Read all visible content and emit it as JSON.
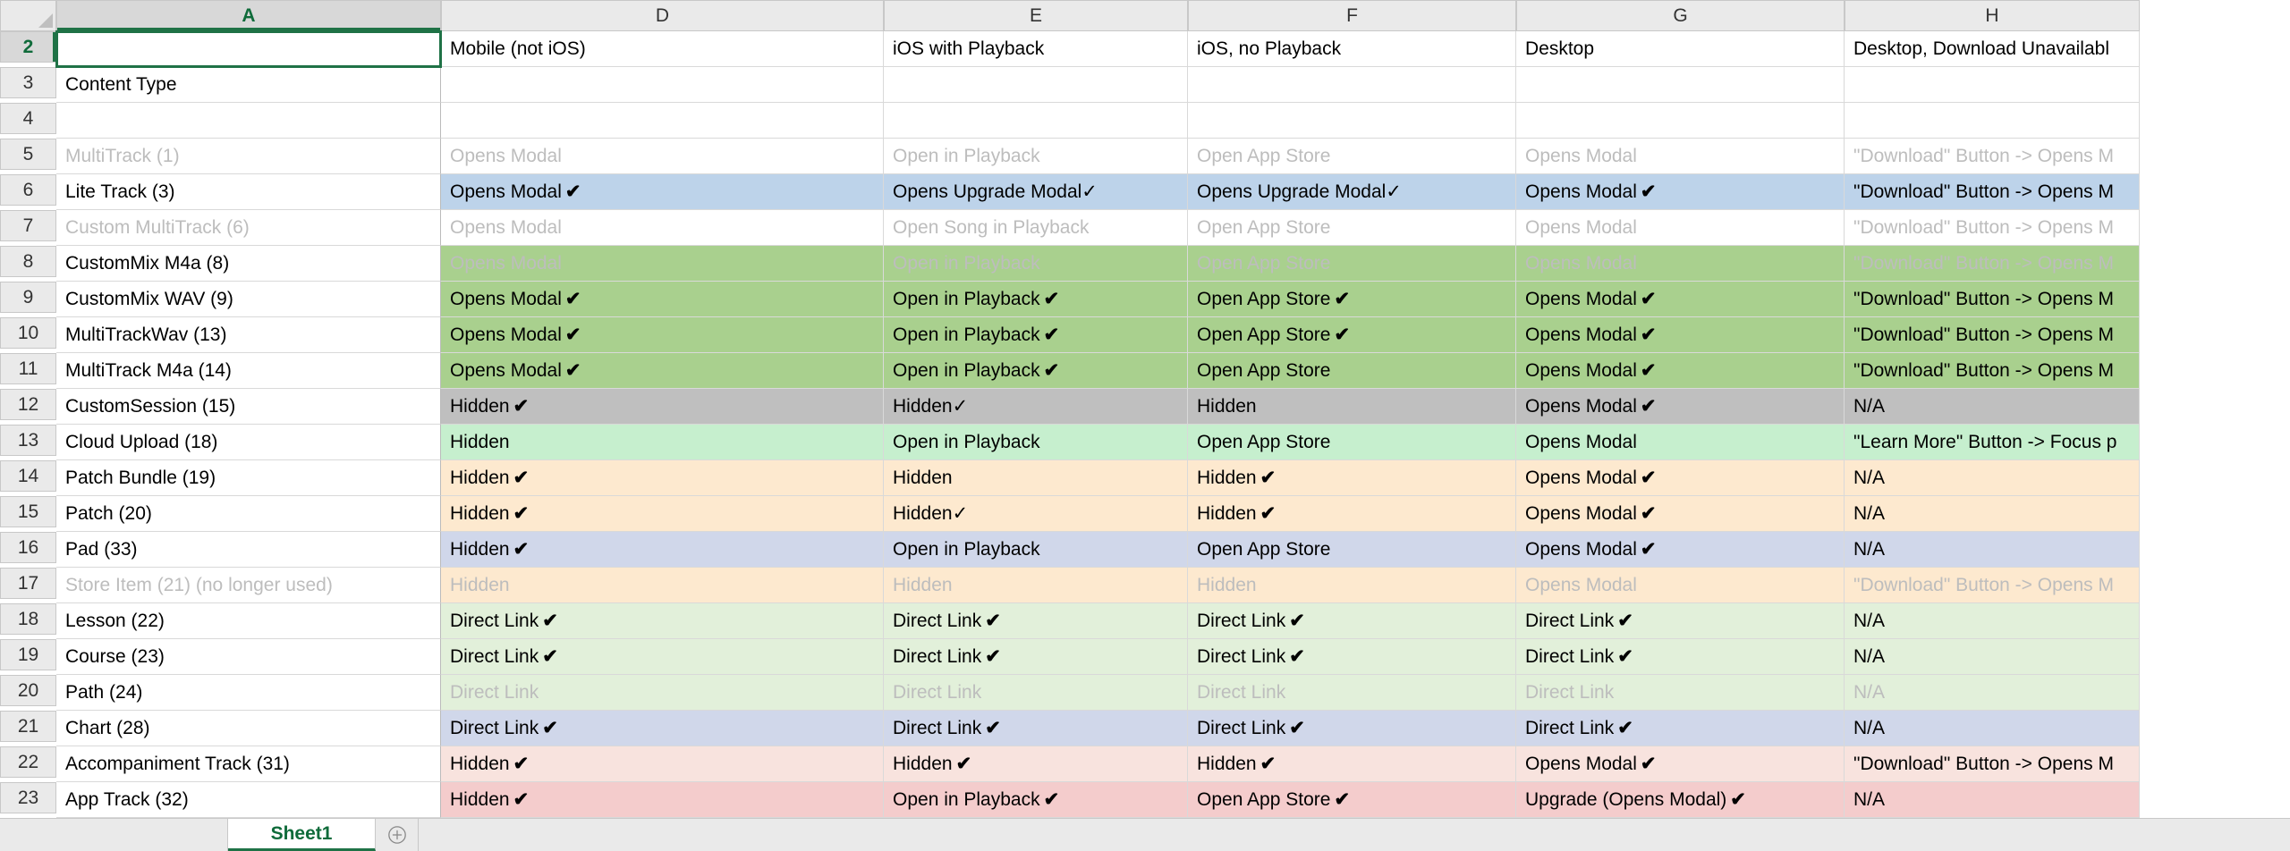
{
  "column_headers": [
    "A",
    "D",
    "E",
    "F",
    "G",
    "H"
  ],
  "active_column_index": 0,
  "active_row_number": 2,
  "sheet_tab": "Sheet1",
  "rows": [
    {
      "num": 2,
      "active": true,
      "cells": [
        {
          "text": "",
          "selected": true
        },
        {
          "text": "Mobile (not iOS)"
        },
        {
          "text": "iOS with Playback"
        },
        {
          "text": "iOS, no Playback"
        },
        {
          "text": "Desktop"
        },
        {
          "text": "Desktop, Download Unavailabl"
        }
      ]
    },
    {
      "num": 3,
      "cells": [
        {
          "text": "Content Type"
        },
        {
          "text": ""
        },
        {
          "text": ""
        },
        {
          "text": ""
        },
        {
          "text": ""
        },
        {
          "text": ""
        }
      ]
    },
    {
      "num": 4,
      "cells": [
        {
          "text": ""
        },
        {
          "text": ""
        },
        {
          "text": ""
        },
        {
          "text": ""
        },
        {
          "text": ""
        },
        {
          "text": ""
        }
      ]
    },
    {
      "num": 5,
      "cells": [
        {
          "text": "MultiTrack (1)",
          "muted": true
        },
        {
          "text": "Opens Modal",
          "muted": true
        },
        {
          "text": "Open in Playback",
          "muted": true
        },
        {
          "text": "Open App Store",
          "muted": true
        },
        {
          "text": "Opens Modal",
          "muted": true
        },
        {
          "text": "\"Download\" Button -> Opens M",
          "muted": true
        }
      ]
    },
    {
      "num": 6,
      "cells": [
        {
          "text": "Lite Track (3)"
        },
        {
          "text": "Opens Modal",
          "check": true,
          "bg": "bg-blue"
        },
        {
          "text": "Opens Upgrade Modal",
          "check_light": true,
          "bg": "bg-blue"
        },
        {
          "text": "Opens Upgrade Modal",
          "check_light": true,
          "bg": "bg-blue"
        },
        {
          "text": "Opens Modal",
          "check": true,
          "bg": "bg-blue"
        },
        {
          "text": "\"Download\" Button -> Opens M",
          "bg": "bg-blue"
        }
      ]
    },
    {
      "num": 7,
      "cells": [
        {
          "text": "Custom MultiTrack (6)",
          "muted": true
        },
        {
          "text": "Opens Modal",
          "muted": true
        },
        {
          "text": "Open Song in Playback",
          "muted": true
        },
        {
          "text": "Open App Store",
          "muted": true
        },
        {
          "text": "Opens Modal",
          "muted": true
        },
        {
          "text": "\"Download\" Button -> Opens M",
          "muted": true
        }
      ]
    },
    {
      "num": 8,
      "cells": [
        {
          "text": "CustomMix M4a (8)"
        },
        {
          "text": "Opens Modal",
          "muted": true,
          "bg": "bg-green-strong"
        },
        {
          "text": "Open in Playback",
          "muted": true,
          "bg": "bg-green-strong"
        },
        {
          "text": "Open App Store",
          "muted": true,
          "bg": "bg-green-strong"
        },
        {
          "text": "Opens Modal",
          "muted": true,
          "bg": "bg-green-strong"
        },
        {
          "text": "\"Download\" Button -> Opens M",
          "muted": true,
          "bg": "bg-green-strong"
        }
      ]
    },
    {
      "num": 9,
      "cells": [
        {
          "text": "CustomMix WAV (9)"
        },
        {
          "text": "Opens Modal",
          "check": true,
          "bg": "bg-green-strong"
        },
        {
          "text": "Open in Playback",
          "check": true,
          "bg": "bg-green-strong"
        },
        {
          "text": "Open App Store",
          "check": true,
          "bg": "bg-green-strong"
        },
        {
          "text": "Opens Modal",
          "check": true,
          "bg": "bg-green-strong"
        },
        {
          "text": "\"Download\" Button -> Opens M",
          "bg": "bg-green-strong"
        }
      ]
    },
    {
      "num": 10,
      "cells": [
        {
          "text": "MultiTrackWav (13)"
        },
        {
          "text": "Opens Modal",
          "check": true,
          "bg": "bg-green-strong"
        },
        {
          "text": "Open in Playback",
          "check": true,
          "bg": "bg-green-strong"
        },
        {
          "text": "Open App Store",
          "check": true,
          "bg": "bg-green-strong"
        },
        {
          "text": "Opens Modal",
          "check": true,
          "bg": "bg-green-strong"
        },
        {
          "text": "\"Download\" Button -> Opens M",
          "bg": "bg-green-strong"
        }
      ]
    },
    {
      "num": 11,
      "cells": [
        {
          "text": "MultiTrack M4a (14)"
        },
        {
          "text": "Opens Modal",
          "check": true,
          "bg": "bg-green-strong"
        },
        {
          "text": "Open in Playback",
          "check": true,
          "bg": "bg-green-strong"
        },
        {
          "text": "Open App Store",
          "bg": "bg-green-strong"
        },
        {
          "text": "Opens Modal",
          "check": true,
          "bg": "bg-green-strong"
        },
        {
          "text": "\"Download\" Button -> Opens M",
          "bg": "bg-green-strong"
        }
      ]
    },
    {
      "num": 12,
      "cells": [
        {
          "text": "CustomSession (15)"
        },
        {
          "text": "Hidden",
          "check": true,
          "bg": "bg-gray"
        },
        {
          "text": "Hidden",
          "check_light": true,
          "bg": "bg-gray"
        },
        {
          "text": "Hidden",
          "bg": "bg-gray"
        },
        {
          "text": "Opens Modal",
          "check": true,
          "bg": "bg-gray"
        },
        {
          "text": "N/A",
          "bg": "bg-gray"
        }
      ]
    },
    {
      "num": 13,
      "cells": [
        {
          "text": "Cloud Upload (18)"
        },
        {
          "text": "Hidden",
          "bg": "bg-green"
        },
        {
          "text": "Open in Playback",
          "bg": "bg-green"
        },
        {
          "text": "Open App Store",
          "bg": "bg-green"
        },
        {
          "text": "Opens Modal",
          "bg": "bg-green"
        },
        {
          "text": "\"Learn More\" Button -> Focus p",
          "bg": "bg-green"
        }
      ]
    },
    {
      "num": 14,
      "cells": [
        {
          "text": "Patch Bundle (19)"
        },
        {
          "text": "Hidden",
          "check": true,
          "bg": "bg-tan"
        },
        {
          "text": "Hidden",
          "bg": "bg-tan"
        },
        {
          "text": "Hidden",
          "check": true,
          "bg": "bg-tan"
        },
        {
          "text": "Opens Modal",
          "check": true,
          "bg": "bg-tan"
        },
        {
          "text": "N/A",
          "bg": "bg-tan"
        }
      ]
    },
    {
      "num": 15,
      "cells": [
        {
          "text": "Patch (20)"
        },
        {
          "text": "Hidden",
          "check": true,
          "bg": "bg-tan"
        },
        {
          "text": "Hidden",
          "check_light": true,
          "bg": "bg-tan"
        },
        {
          "text": "Hidden",
          "check": true,
          "bg": "bg-tan"
        },
        {
          "text": "Opens Modal",
          "check": true,
          "bg": "bg-tan"
        },
        {
          "text": "N/A",
          "bg": "bg-tan"
        }
      ]
    },
    {
      "num": 16,
      "cells": [
        {
          "text": "Pad (33)"
        },
        {
          "text": "Hidden",
          "check": true,
          "bg": "bg-lav"
        },
        {
          "text": "Open in Playback",
          "bg": "bg-lav"
        },
        {
          "text": "Open App Store",
          "bg": "bg-lav"
        },
        {
          "text": "Opens Modal",
          "check": true,
          "bg": "bg-lav"
        },
        {
          "text": "N/A",
          "bg": "bg-lav"
        }
      ]
    },
    {
      "num": 17,
      "cells": [
        {
          "text": "Store Item (21) (no longer used)",
          "muted": true
        },
        {
          "text": "Hidden",
          "muted": true,
          "bg": "bg-tan"
        },
        {
          "text": "Hidden",
          "muted": true,
          "bg": "bg-tan"
        },
        {
          "text": "Hidden",
          "muted": true,
          "bg": "bg-tan"
        },
        {
          "text": "Opens Modal",
          "muted": true,
          "bg": "bg-tan"
        },
        {
          "text": "\"Download\" Button -> Opens M",
          "muted": true,
          "bg": "bg-tan"
        }
      ]
    },
    {
      "num": 18,
      "cells": [
        {
          "text": "Lesson (22)"
        },
        {
          "text": "Direct Link",
          "check": true,
          "bg": "bg-green-soft"
        },
        {
          "text": "Direct Link",
          "check": true,
          "bg": "bg-green-soft"
        },
        {
          "text": "Direct Link",
          "check": true,
          "bg": "bg-green-soft"
        },
        {
          "text": "Direct Link",
          "check": true,
          "bg": "bg-green-soft"
        },
        {
          "text": "N/A",
          "bg": "bg-green-soft"
        }
      ]
    },
    {
      "num": 19,
      "cells": [
        {
          "text": "Course (23)"
        },
        {
          "text": "Direct Link",
          "check": true,
          "bg": "bg-green-soft"
        },
        {
          "text": "Direct Link",
          "check": true,
          "bg": "bg-green-soft"
        },
        {
          "text": "Direct Link",
          "check": true,
          "bg": "bg-green-soft"
        },
        {
          "text": "Direct Link",
          "check": true,
          "bg": "bg-green-soft"
        },
        {
          "text": "N/A",
          "bg": "bg-green-soft"
        }
      ]
    },
    {
      "num": 20,
      "cells": [
        {
          "text": "Path (24)"
        },
        {
          "text": "Direct Link",
          "muted": true,
          "bg": "bg-green-soft"
        },
        {
          "text": "Direct Link",
          "muted": true,
          "bg": "bg-green-soft"
        },
        {
          "text": "Direct Link",
          "muted": true,
          "bg": "bg-green-soft"
        },
        {
          "text": "Direct Link",
          "muted": true,
          "bg": "bg-green-soft"
        },
        {
          "text": "N/A",
          "muted": true,
          "bg": "bg-green-soft"
        }
      ]
    },
    {
      "num": 21,
      "cells": [
        {
          "text": "Chart (28)"
        },
        {
          "text": "Direct Link",
          "check": true,
          "bg": "bg-lav"
        },
        {
          "text": "Direct Link",
          "check": true,
          "bg": "bg-lav"
        },
        {
          "text": "Direct Link",
          "check": true,
          "bg": "bg-lav"
        },
        {
          "text": "Direct Link",
          "check": true,
          "bg": "bg-lav"
        },
        {
          "text": "N/A",
          "bg": "bg-lav"
        }
      ]
    },
    {
      "num": 22,
      "cells": [
        {
          "text": "Accompaniment Track (31)"
        },
        {
          "text": "Hidden",
          "check": true,
          "bg": "bg-peach"
        },
        {
          "text": "Hidden",
          "check": true,
          "bg": "bg-peach"
        },
        {
          "text": "Hidden",
          "check": true,
          "bg": "bg-peach"
        },
        {
          "text": "Opens Modal",
          "check": true,
          "bg": "bg-peach"
        },
        {
          "text": "\"Download\" Button -> Opens M",
          "bg": "bg-peach"
        }
      ]
    },
    {
      "num": 23,
      "cells": [
        {
          "text": "App Track (32)"
        },
        {
          "text": "Hidden",
          "check": true,
          "bg": "bg-pink"
        },
        {
          "text": "Open in Playback",
          "check": true,
          "bg": "bg-pink"
        },
        {
          "text": "Open App Store",
          "check": true,
          "bg": "bg-pink"
        },
        {
          "text": "Upgrade (Opens Modal)",
          "check": true,
          "bg": "bg-pink"
        },
        {
          "text": "N/A",
          "bg": "bg-pink"
        }
      ]
    }
  ]
}
